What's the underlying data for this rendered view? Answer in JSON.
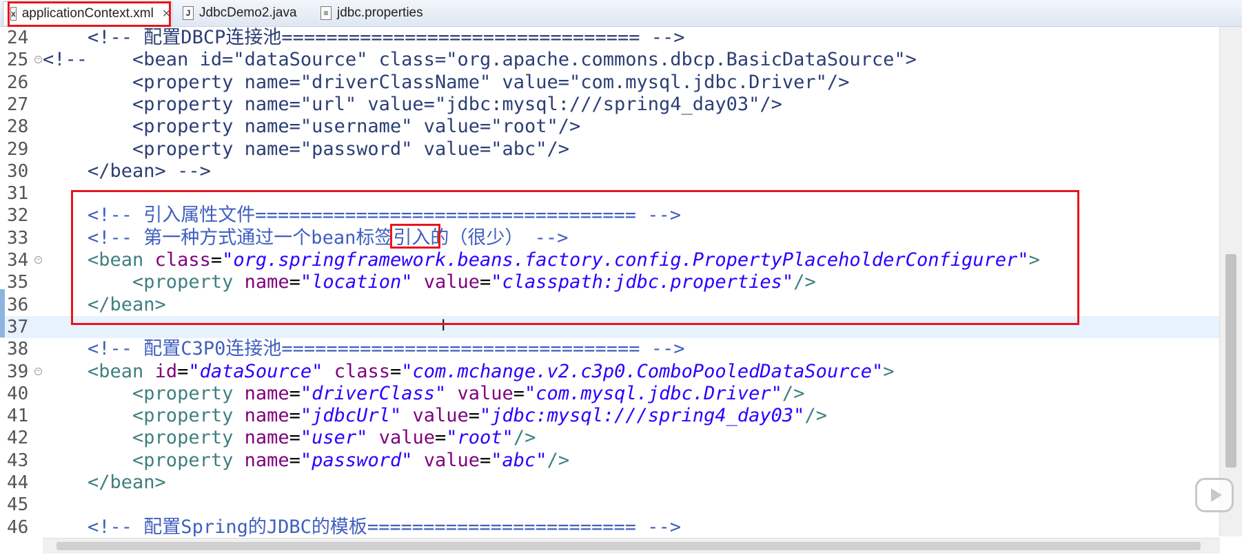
{
  "tabs": [
    {
      "label": "applicationContext.xml",
      "icon": "xml-file-icon",
      "active": true
    },
    {
      "label": "JdbcDemo2.java",
      "icon": "java-file-icon",
      "active": false
    },
    {
      "label": "jdbc.properties",
      "icon": "properties-file-icon",
      "active": false
    }
  ],
  "colors": {
    "comment": "#3f5fbf",
    "tag": "#3f7f7f",
    "attribute": "#7f007f",
    "value": "#2a00ff",
    "highlight": "#e8141b",
    "current_line": "#e8f2fe"
  },
  "editor": {
    "current_line": 37,
    "lines": [
      {
        "n": 24,
        "seg": [
          [
            "    ",
            "txt"
          ],
          [
            "<!-- 配置DBCP连接池================================ -->",
            "cmd"
          ]
        ]
      },
      {
        "n": 25,
        "fold": true,
        "seg": [
          [
            "<!--    <bean id=\"dataSource\" class=\"org.apache.commons.dbcp.BasicDataSource\">",
            "cmd"
          ]
        ]
      },
      {
        "n": 26,
        "seg": [
          [
            "        <property name=\"driverClassName\" value=\"com.mysql.jdbc.Driver\"/>",
            "cmd"
          ]
        ]
      },
      {
        "n": 27,
        "seg": [
          [
            "        <property name=\"url\" value=\"jdbc:mysql:///spring4_day03\"/>",
            "cmd"
          ]
        ]
      },
      {
        "n": 28,
        "seg": [
          [
            "        <property name=\"username\" value=\"root\"/>",
            "cmd"
          ]
        ]
      },
      {
        "n": 29,
        "seg": [
          [
            "        <property name=\"password\" value=\"abc\"/>",
            "cmd"
          ]
        ]
      },
      {
        "n": 30,
        "seg": [
          [
            "    </bean> -->",
            "cmd"
          ]
        ]
      },
      {
        "n": 31,
        "seg": []
      },
      {
        "n": 32,
        "seg": [
          [
            "    ",
            "txt"
          ],
          [
            "<!-- 引入属性文件================================== -->",
            "cm"
          ]
        ]
      },
      {
        "n": 33,
        "seg": [
          [
            "    ",
            "txt"
          ],
          [
            "<!-- 第一种方式通过一个bean标签引入的（很少） -->",
            "cm"
          ]
        ]
      },
      {
        "n": 34,
        "fold": true,
        "seg": [
          [
            "    <bean ",
            "tag"
          ],
          [
            "class",
            "att"
          ],
          [
            "=",
            "txt"
          ],
          [
            "\"org.springframework.beans.factory.config.PropertyPlaceholderConfigurer\"",
            "val"
          ],
          [
            ">",
            "tag"
          ]
        ]
      },
      {
        "n": 35,
        "seg": [
          [
            "        <property ",
            "tag"
          ],
          [
            "name",
            "att"
          ],
          [
            "=",
            "txt"
          ],
          [
            "\"location\"",
            "val"
          ],
          [
            " ",
            "txt"
          ],
          [
            "value",
            "att"
          ],
          [
            "=",
            "txt"
          ],
          [
            "\"classpath:jdbc.properties\"",
            "val"
          ],
          [
            "/>",
            "tag"
          ]
        ]
      },
      {
        "n": 36,
        "seg": [
          [
            "    </bean>",
            "tag"
          ]
        ]
      },
      {
        "n": 37,
        "seg": []
      },
      {
        "n": 38,
        "seg": [
          [
            "    ",
            "txt"
          ],
          [
            "<!-- 配置C3P0连接池================================ -->",
            "cm"
          ]
        ]
      },
      {
        "n": 39,
        "fold": true,
        "seg": [
          [
            "    <bean ",
            "tag"
          ],
          [
            "id",
            "att"
          ],
          [
            "=",
            "txt"
          ],
          [
            "\"dataSource\"",
            "val"
          ],
          [
            " ",
            "txt"
          ],
          [
            "class",
            "att"
          ],
          [
            "=",
            "txt"
          ],
          [
            "\"com.mchange.v2.c3p0.ComboPooledDataSource\"",
            "val"
          ],
          [
            ">",
            "tag"
          ]
        ]
      },
      {
        "n": 40,
        "seg": [
          [
            "        <property ",
            "tag"
          ],
          [
            "name",
            "att"
          ],
          [
            "=",
            "txt"
          ],
          [
            "\"driverClass\"",
            "val"
          ],
          [
            " ",
            "txt"
          ],
          [
            "value",
            "att"
          ],
          [
            "=",
            "txt"
          ],
          [
            "\"com.mysql.jdbc.Driver\"",
            "val"
          ],
          [
            "/>",
            "tag"
          ]
        ]
      },
      {
        "n": 41,
        "seg": [
          [
            "        <property ",
            "tag"
          ],
          [
            "name",
            "att"
          ],
          [
            "=",
            "txt"
          ],
          [
            "\"jdbcUrl\"",
            "val"
          ],
          [
            " ",
            "txt"
          ],
          [
            "value",
            "att"
          ],
          [
            "=",
            "txt"
          ],
          [
            "\"jdbc:mysql:///spring4_day03\"",
            "val"
          ],
          [
            "/>",
            "tag"
          ]
        ]
      },
      {
        "n": 42,
        "seg": [
          [
            "        <property ",
            "tag"
          ],
          [
            "name",
            "att"
          ],
          [
            "=",
            "txt"
          ],
          [
            "\"user\"",
            "val"
          ],
          [
            " ",
            "txt"
          ],
          [
            "value",
            "att"
          ],
          [
            "=",
            "txt"
          ],
          [
            "\"root\"",
            "val"
          ],
          [
            "/>",
            "tag"
          ]
        ]
      },
      {
        "n": 43,
        "seg": [
          [
            "        <property ",
            "tag"
          ],
          [
            "name",
            "att"
          ],
          [
            "=",
            "txt"
          ],
          [
            "\"password\"",
            "val"
          ],
          [
            " ",
            "txt"
          ],
          [
            "value",
            "att"
          ],
          [
            "=",
            "txt"
          ],
          [
            "\"abc\"",
            "val"
          ],
          [
            "/>",
            "tag"
          ]
        ]
      },
      {
        "n": 44,
        "seg": [
          [
            "    </bean>",
            "tag"
          ]
        ]
      },
      {
        "n": 45,
        "seg": []
      },
      {
        "n": 46,
        "seg": [
          [
            "    ",
            "txt"
          ],
          [
            "<!-- 配置Spring的JDBC的模板======================== -->",
            "cm"
          ]
        ]
      }
    ]
  }
}
